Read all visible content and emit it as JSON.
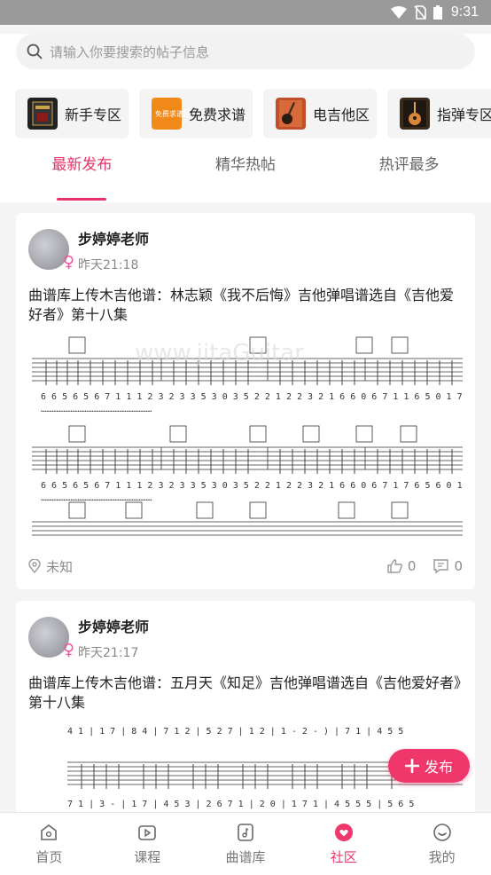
{
  "status_bar": {
    "time": "9:31"
  },
  "search": {
    "placeholder": "请输入你要搜索的帖子信息"
  },
  "categories": [
    {
      "label": "新手专区",
      "icon": "book-icon",
      "color": "#222222"
    },
    {
      "label": "免费求谱",
      "icon": "free-score-icon",
      "color": "#f28a1a",
      "badge_text": "免费求谱区"
    },
    {
      "label": "电吉他区",
      "icon": "electric-guitar-icon",
      "color": "#c0502b"
    },
    {
      "label": "指弹专区",
      "icon": "acoustic-guitar-icon",
      "color": "#3a2a1a"
    }
  ],
  "tabs": [
    {
      "label": "最新发布",
      "active": true
    },
    {
      "label": "精华热帖",
      "active": false
    },
    {
      "label": "热评最多",
      "active": false
    }
  ],
  "posts": [
    {
      "author": "步婷婷老师",
      "time": "昨天21:18",
      "title": "曲谱库上传木吉他谱：林志颖《我不后悔》吉他弹唱谱选自《吉他爱好者》第十八集",
      "location": "未知",
      "likes": "0",
      "comments": "0"
    },
    {
      "author": "步婷婷老师",
      "time": "昨天21:17",
      "title": "曲谱库上传木吉他谱：五月天《知足》吉他弹唱谱选自《吉他爱好者》第十八集"
    }
  ],
  "fab": {
    "label": "发布"
  },
  "nav": [
    {
      "label": "首页",
      "icon": "home-icon",
      "active": false
    },
    {
      "label": "课程",
      "icon": "course-icon",
      "active": false
    },
    {
      "label": "曲谱库",
      "icon": "score-library-icon",
      "active": false
    },
    {
      "label": "社区",
      "icon": "community-icon",
      "active": true
    },
    {
      "label": "我的",
      "icon": "profile-icon",
      "active": false
    }
  ],
  "colors": {
    "accent": "#f0376c",
    "tab_active": "#e8336a"
  }
}
